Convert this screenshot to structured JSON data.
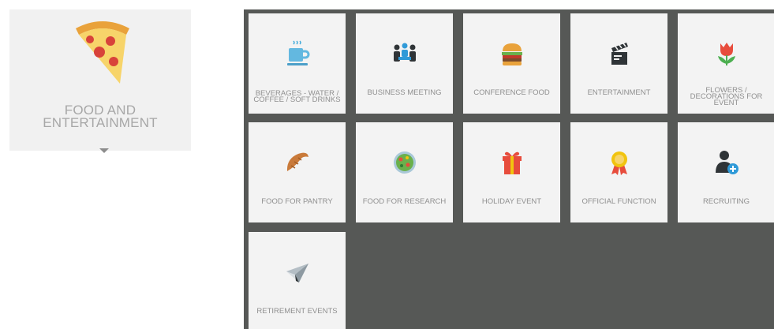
{
  "category": {
    "label_line1": "FOOD AND",
    "label_line2": "ENTERTAINMENT",
    "icon": "pizza-slice-icon"
  },
  "tiles": [
    {
      "label": "BEVERAGES - WATER / COFFEE / SOFT DRINKS",
      "icon": "coffee-cup-icon"
    },
    {
      "label": "BUSINESS MEETING",
      "icon": "people-meeting-icon"
    },
    {
      "label": "CONFERENCE FOOD",
      "icon": "burger-icon"
    },
    {
      "label": "ENTERTAINMENT",
      "icon": "clapperboard-icon"
    },
    {
      "label": "FLOWERS / DECORATIONS FOR EVENT",
      "icon": "tulip-icon"
    },
    {
      "label": "FOOD FOR PANTRY",
      "icon": "croissant-icon"
    },
    {
      "label": "FOOD FOR RESEARCH",
      "icon": "salad-bowl-icon"
    },
    {
      "label": "HOLIDAY EVENT",
      "icon": "gift-box-icon"
    },
    {
      "label": "OFFICIAL FUNCTION",
      "icon": "award-ribbon-icon"
    },
    {
      "label": "RECRUITING",
      "icon": "add-user-icon"
    },
    {
      "label": "RETIREMENT EVENTS",
      "icon": "paper-plane-icon"
    }
  ],
  "colors": {
    "panel_bg": "#565856",
    "tile_bg": "#f3f3f3",
    "label_text": "#8f8f8f"
  }
}
